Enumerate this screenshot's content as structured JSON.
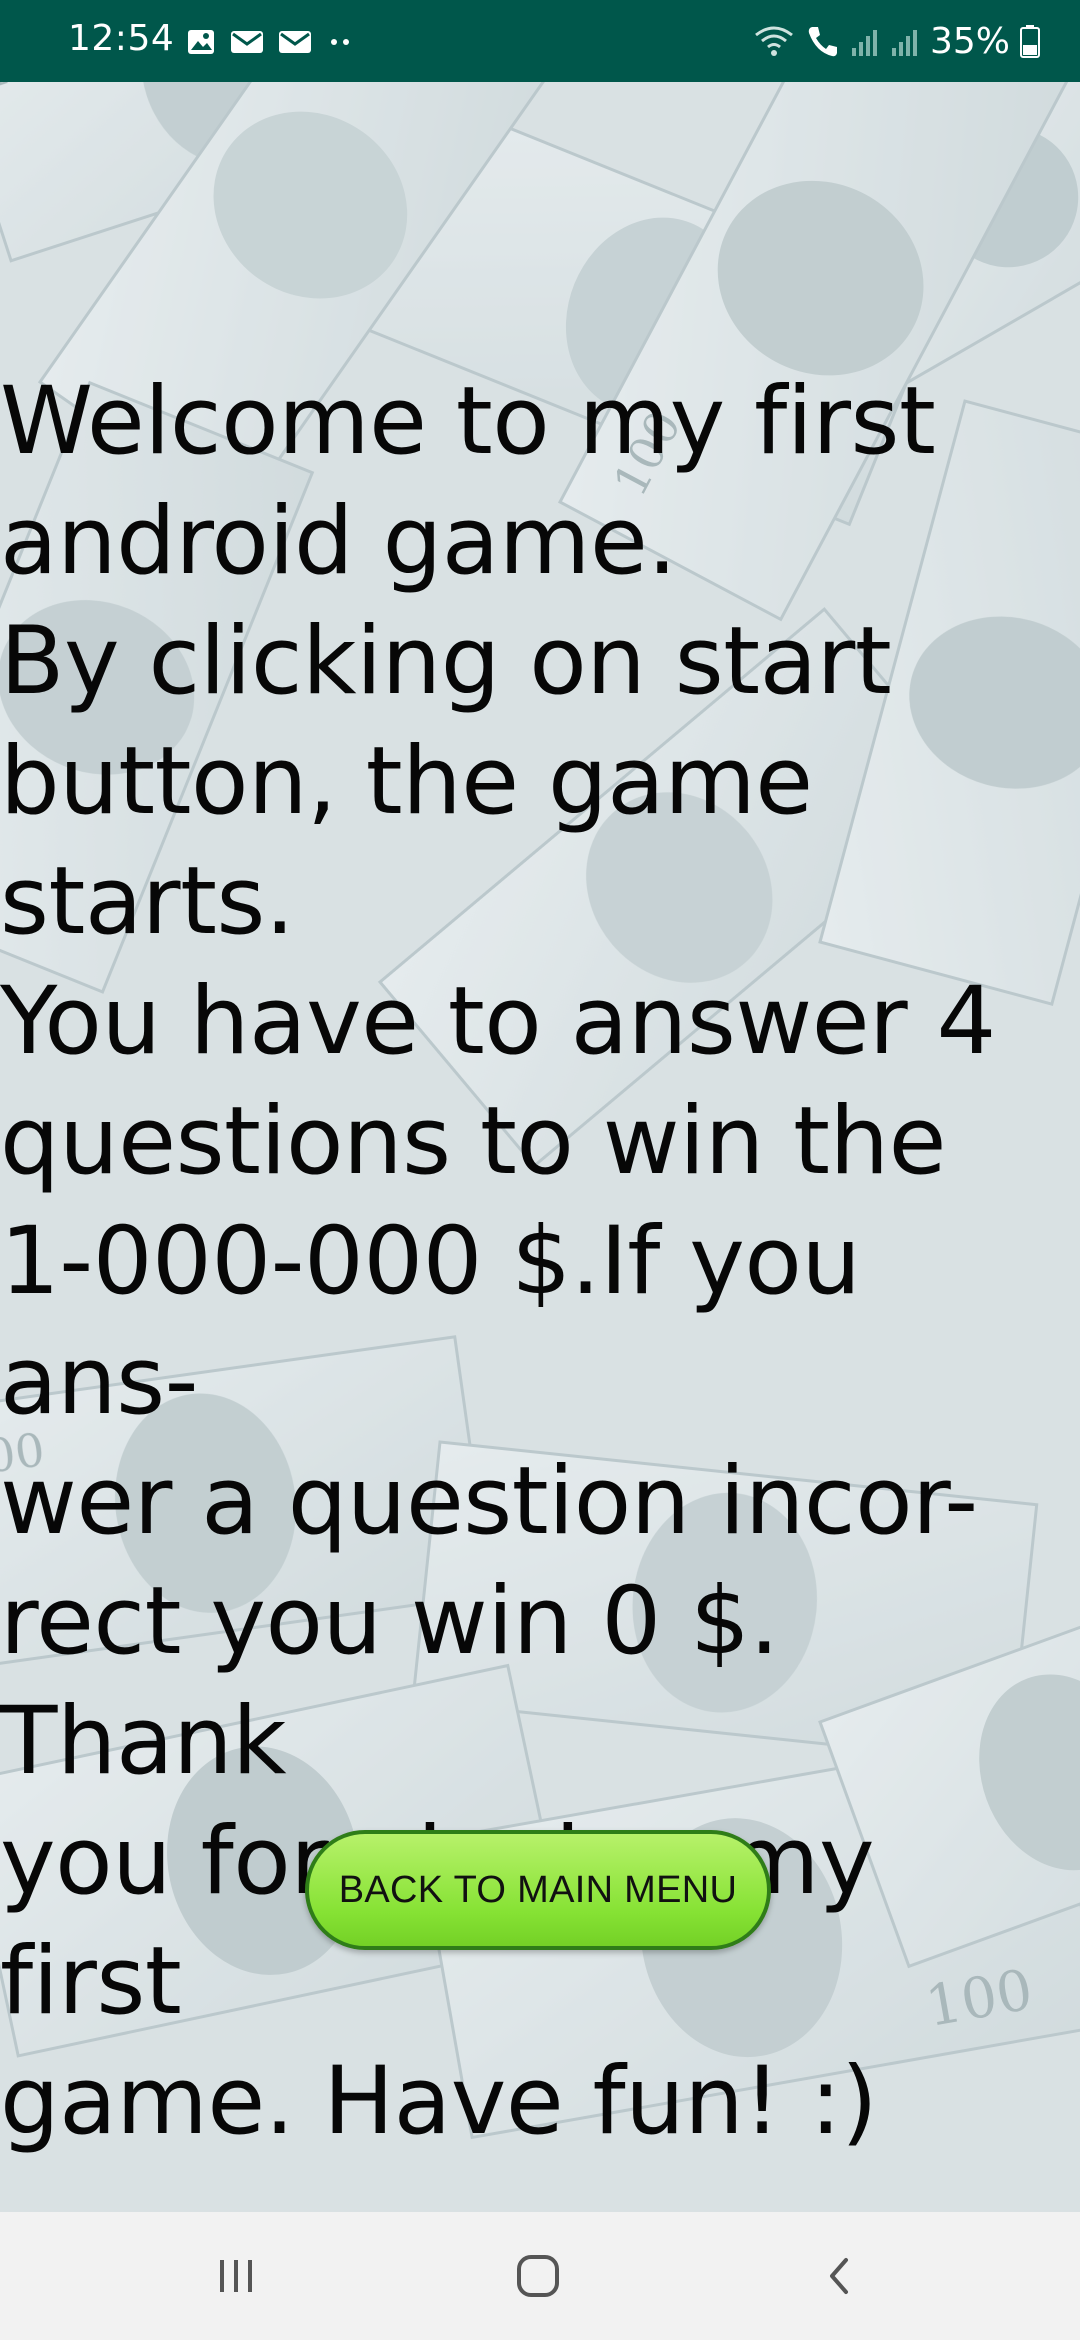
{
  "status_bar": {
    "time": "12:54",
    "battery": "35%",
    "left_icons": [
      "image-icon",
      "mail-icon",
      "mail-icon",
      "more-dots-icon"
    ],
    "right_icons": [
      "wifi-call-icon",
      "signal-icon",
      "signal-icon",
      "battery-icon"
    ]
  },
  "intro": {
    "text": "Welcome to my first\nandroid game.\nBy clicking on start\nbutton, the game starts.\nYou have to answer 4\nquestions to win the\n1-000-000 $.If you ans-\nwer a question incor-\nrect you win 0 $. Thank\nyou for playing my first\ngame. Have fun! :)"
  },
  "back_button": {
    "label": "BACK TO MAIN MENU"
  },
  "nav_bar": {
    "icons": [
      "recent-apps-icon",
      "home-icon",
      "back-icon"
    ]
  },
  "colors": {
    "status_bar": "#00574b",
    "button_green": "#86e234",
    "button_border": "#2f7d18",
    "nav_bar": "#f2f2f2"
  }
}
